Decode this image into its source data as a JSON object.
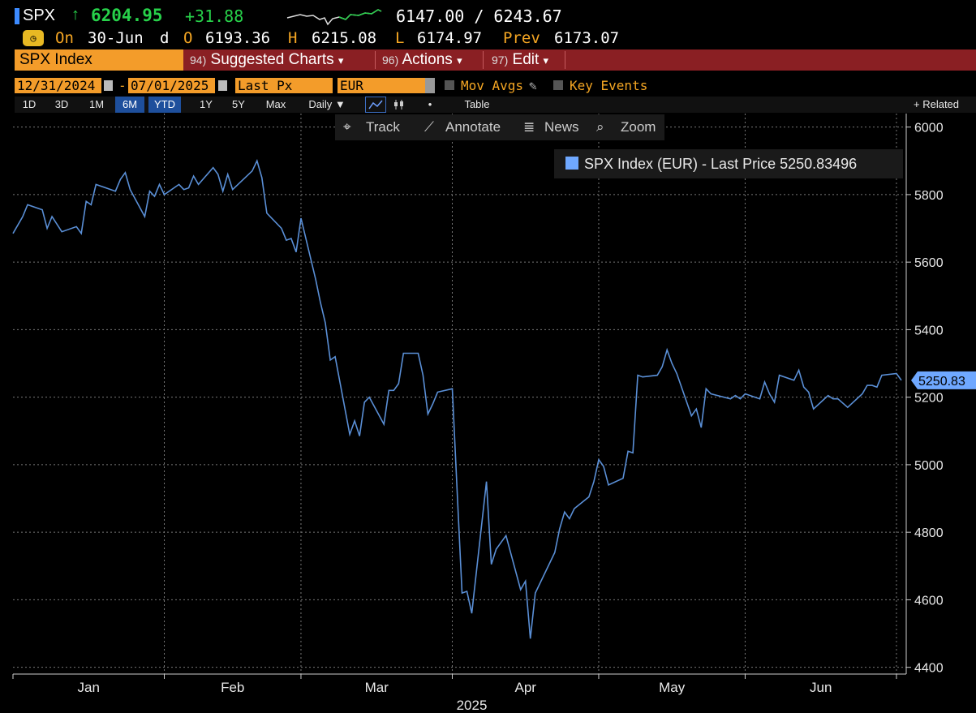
{
  "quote": {
    "symbol": "SPX",
    "arrow": "↑",
    "last": "6204.95",
    "change": "+31.88",
    "range": "6147.00 / 6243.67"
  },
  "ohlc": {
    "on_label": "On",
    "date": "30-Jun",
    "d": "d",
    "o_label": "O",
    "o_value": "6193.36",
    "h_label": "H",
    "h_value": "6215.08",
    "l_label": "L",
    "l_value": "6174.97",
    "prev_label": "Prev",
    "prev_value": "6173.07"
  },
  "command_bar": {
    "security": "SPX Index",
    "suggested_num": "94)",
    "suggested": "Suggested Charts",
    "actions_num": "96)",
    "actions": "Actions",
    "edit_num": "97)",
    "edit": "Edit",
    "dropdown_glyph": "▾"
  },
  "settings": {
    "start_date": "12/31/2024",
    "date_sep": "-",
    "end_date": "07/01/2025",
    "field": "Last Px",
    "currency": "EUR",
    "mov_avgs": "Mov Avgs",
    "key_events": "Key Events"
  },
  "tabs": {
    "periods": [
      "1D",
      "3D",
      "1M",
      "6M",
      "YTD",
      "1Y",
      "5Y",
      "Max"
    ],
    "selected": [
      "6M",
      "YTD"
    ],
    "frequency": "Daily ▼",
    "table": "Table",
    "related": "+ Related",
    "dot": "•"
  },
  "tools": {
    "track": "Track",
    "annotate": "Annotate",
    "news": "News",
    "zoom": "Zoom"
  },
  "colors": {
    "line": "#5a8fd6",
    "accent_orange": "#f39c2a",
    "command_red": "#8a1f23",
    "up_green": "#27d14a"
  },
  "chart_data": {
    "type": "line",
    "title": "",
    "xlabel": "2025",
    "ylabel": "",
    "ylim": [
      4380,
      6040
    ],
    "yticks": [
      4400,
      4600,
      4800,
      5000,
      5200,
      5400,
      5600,
      5800,
      6000
    ],
    "month_labels": [
      "Jan",
      "Feb",
      "Mar",
      "Apr",
      "May",
      "Jun"
    ],
    "grid": true,
    "legend": "top-right",
    "last_price_label": "5250.83",
    "series": [
      {
        "name": "SPX Index (EUR) - Last Price 5250.83496",
        "x": [
          "2024-12-31",
          "2025-01-02",
          "2025-01-03",
          "2025-01-06",
          "2025-01-07",
          "2025-01-08",
          "2025-01-10",
          "2025-01-13",
          "2025-01-14",
          "2025-01-15",
          "2025-01-16",
          "2025-01-17",
          "2025-01-21",
          "2025-01-22",
          "2025-01-23",
          "2025-01-24",
          "2025-01-27",
          "2025-01-28",
          "2025-01-29",
          "2025-01-30",
          "2025-01-31",
          "2025-02-03",
          "2025-02-04",
          "2025-02-05",
          "2025-02-06",
          "2025-02-07",
          "2025-02-10",
          "2025-02-11",
          "2025-02-12",
          "2025-02-13",
          "2025-02-14",
          "2025-02-18",
          "2025-02-19",
          "2025-02-20",
          "2025-02-21",
          "2025-02-24",
          "2025-02-25",
          "2025-02-26",
          "2025-02-27",
          "2025-02-28",
          "2025-03-03",
          "2025-03-04",
          "2025-03-05",
          "2025-03-06",
          "2025-03-07",
          "2025-03-10",
          "2025-03-11",
          "2025-03-12",
          "2025-03-13",
          "2025-03-14",
          "2025-03-17",
          "2025-03-18",
          "2025-03-19",
          "2025-03-20",
          "2025-03-21",
          "2025-03-24",
          "2025-03-25",
          "2025-03-26",
          "2025-03-27",
          "2025-03-28",
          "2025-03-31",
          "2025-04-01",
          "2025-04-02",
          "2025-04-03",
          "2025-04-04",
          "2025-04-07",
          "2025-04-08",
          "2025-04-09",
          "2025-04-10",
          "2025-04-11",
          "2025-04-14",
          "2025-04-15",
          "2025-04-16",
          "2025-04-17",
          "2025-04-21",
          "2025-04-22",
          "2025-04-23",
          "2025-04-24",
          "2025-04-25",
          "2025-04-28",
          "2025-04-29",
          "2025-04-30",
          "2025-05-01",
          "2025-05-02",
          "2025-05-05",
          "2025-05-06",
          "2025-05-07",
          "2025-05-08",
          "2025-05-09",
          "2025-05-12",
          "2025-05-13",
          "2025-05-14",
          "2025-05-15",
          "2025-05-16",
          "2025-05-19",
          "2025-05-20",
          "2025-05-21",
          "2025-05-22",
          "2025-05-23",
          "2025-05-27",
          "2025-05-28",
          "2025-05-29",
          "2025-05-30",
          "2025-06-02",
          "2025-06-03",
          "2025-06-04",
          "2025-06-05",
          "2025-06-06",
          "2025-06-09",
          "2025-06-10",
          "2025-06-11",
          "2025-06-12",
          "2025-06-13",
          "2025-06-16",
          "2025-06-17",
          "2025-06-18",
          "2025-06-20",
          "2025-06-23",
          "2025-06-24",
          "2025-06-25",
          "2025-06-26",
          "2025-06-27",
          "2025-06-30",
          "2025-07-01"
        ],
        "values": [
          5685,
          5735,
          5770,
          5755,
          5700,
          5735,
          5690,
          5705,
          5685,
          5780,
          5770,
          5830,
          5810,
          5845,
          5865,
          5815,
          5735,
          5810,
          5795,
          5830,
          5800,
          5830,
          5815,
          5820,
          5855,
          5830,
          5880,
          5860,
          5810,
          5860,
          5815,
          5870,
          5900,
          5850,
          5745,
          5700,
          5665,
          5670,
          5630,
          5730,
          5550,
          5480,
          5420,
          5310,
          5320,
          5090,
          5130,
          5085,
          5185,
          5200,
          5120,
          5220,
          5220,
          5240,
          5330,
          5330,
          5265,
          5150,
          5180,
          5215,
          5225,
          4920,
          4620,
          4625,
          4560,
          4950,
          4705,
          4750,
          4770,
          4790,
          4630,
          4655,
          4485,
          4620,
          4740,
          4810,
          4860,
          4840,
          4870,
          4905,
          4950,
          5015,
          4995,
          4940,
          4960,
          5040,
          5035,
          5265,
          5260,
          5265,
          5290,
          5340,
          5300,
          5270,
          5145,
          5165,
          5110,
          5225,
          5210,
          5195,
          5205,
          5195,
          5210,
          5195,
          5245,
          5210,
          5185,
          5265,
          5250,
          5280,
          5230,
          5215,
          5165,
          5205,
          5195,
          5195,
          5170,
          5210,
          5235,
          5235,
          5230,
          5265,
          5270,
          5250
        ]
      }
    ]
  }
}
